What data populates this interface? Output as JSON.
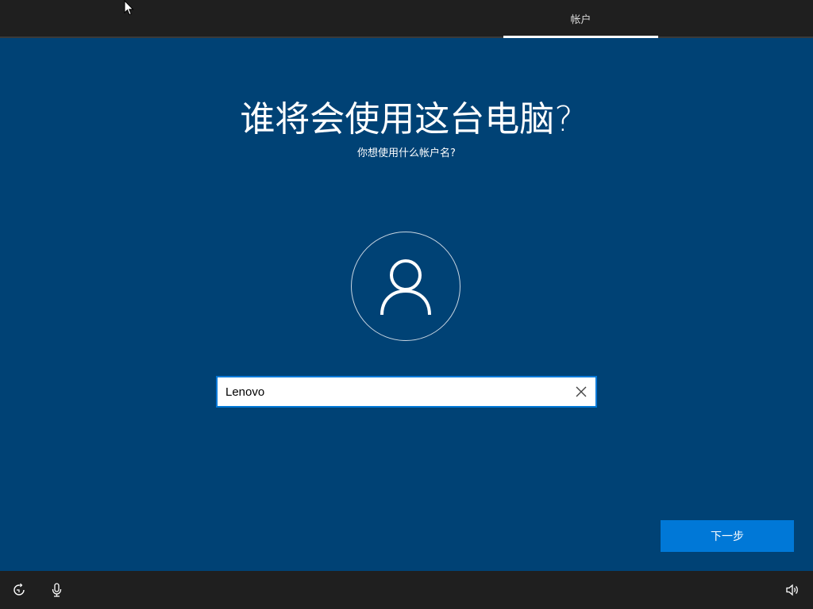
{
  "header": {
    "tab_label": "帐户"
  },
  "main": {
    "title": "谁将会使用这台电脑?",
    "subtitle": "你想使用什么帐户名?",
    "username_value": "Lenovo",
    "next_label": "下一步"
  },
  "icons": {
    "cursor": "mouse-pointer-icon",
    "avatar": "user-icon",
    "clear": "close-icon",
    "ease_of_access": "ease-of-access-icon",
    "microphone": "microphone-icon",
    "volume": "volume-icon"
  },
  "colors": {
    "background": "#004275",
    "bar": "#1f1f1f",
    "accent": "#0078d7"
  }
}
